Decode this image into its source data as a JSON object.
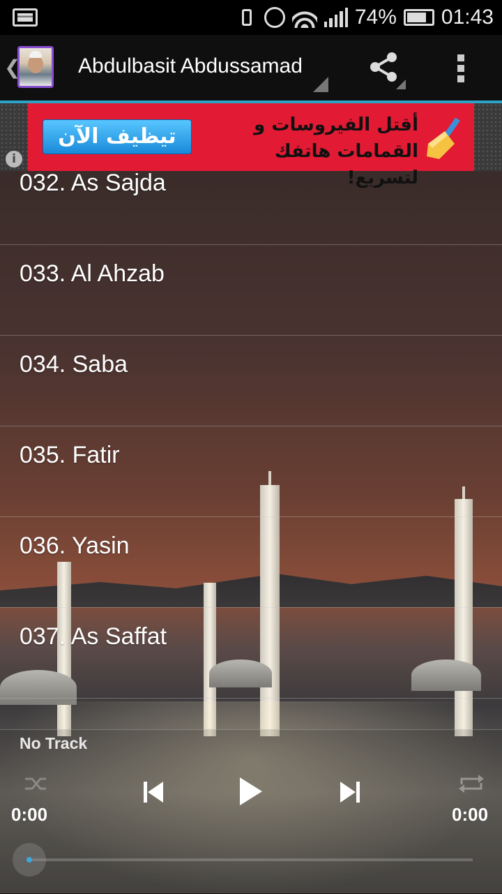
{
  "status_bar": {
    "battery_percent": "74%",
    "time": "01:43"
  },
  "action_bar": {
    "title": "Abdulbasit Abdussamad"
  },
  "ad": {
    "button_label": "تيظيف الآن",
    "line1": "أقتل الفيروسات و",
    "line2": "القمامات هاتفك لتسريع!"
  },
  "tracks": [
    "032. As Sajda",
    "033. Al Ahzab",
    "034. Saba",
    "035. Fatir",
    "036. Yasin",
    "037. As Saffat"
  ],
  "player": {
    "now_playing": "No Track",
    "elapsed": "0:00",
    "duration": "0:00",
    "progress": 0
  },
  "colors": {
    "accent": "#2ea3c8",
    "ad_background": "#e21a33",
    "ad_button": "#1a8ad9",
    "seek_dot": "#39a9dc"
  }
}
